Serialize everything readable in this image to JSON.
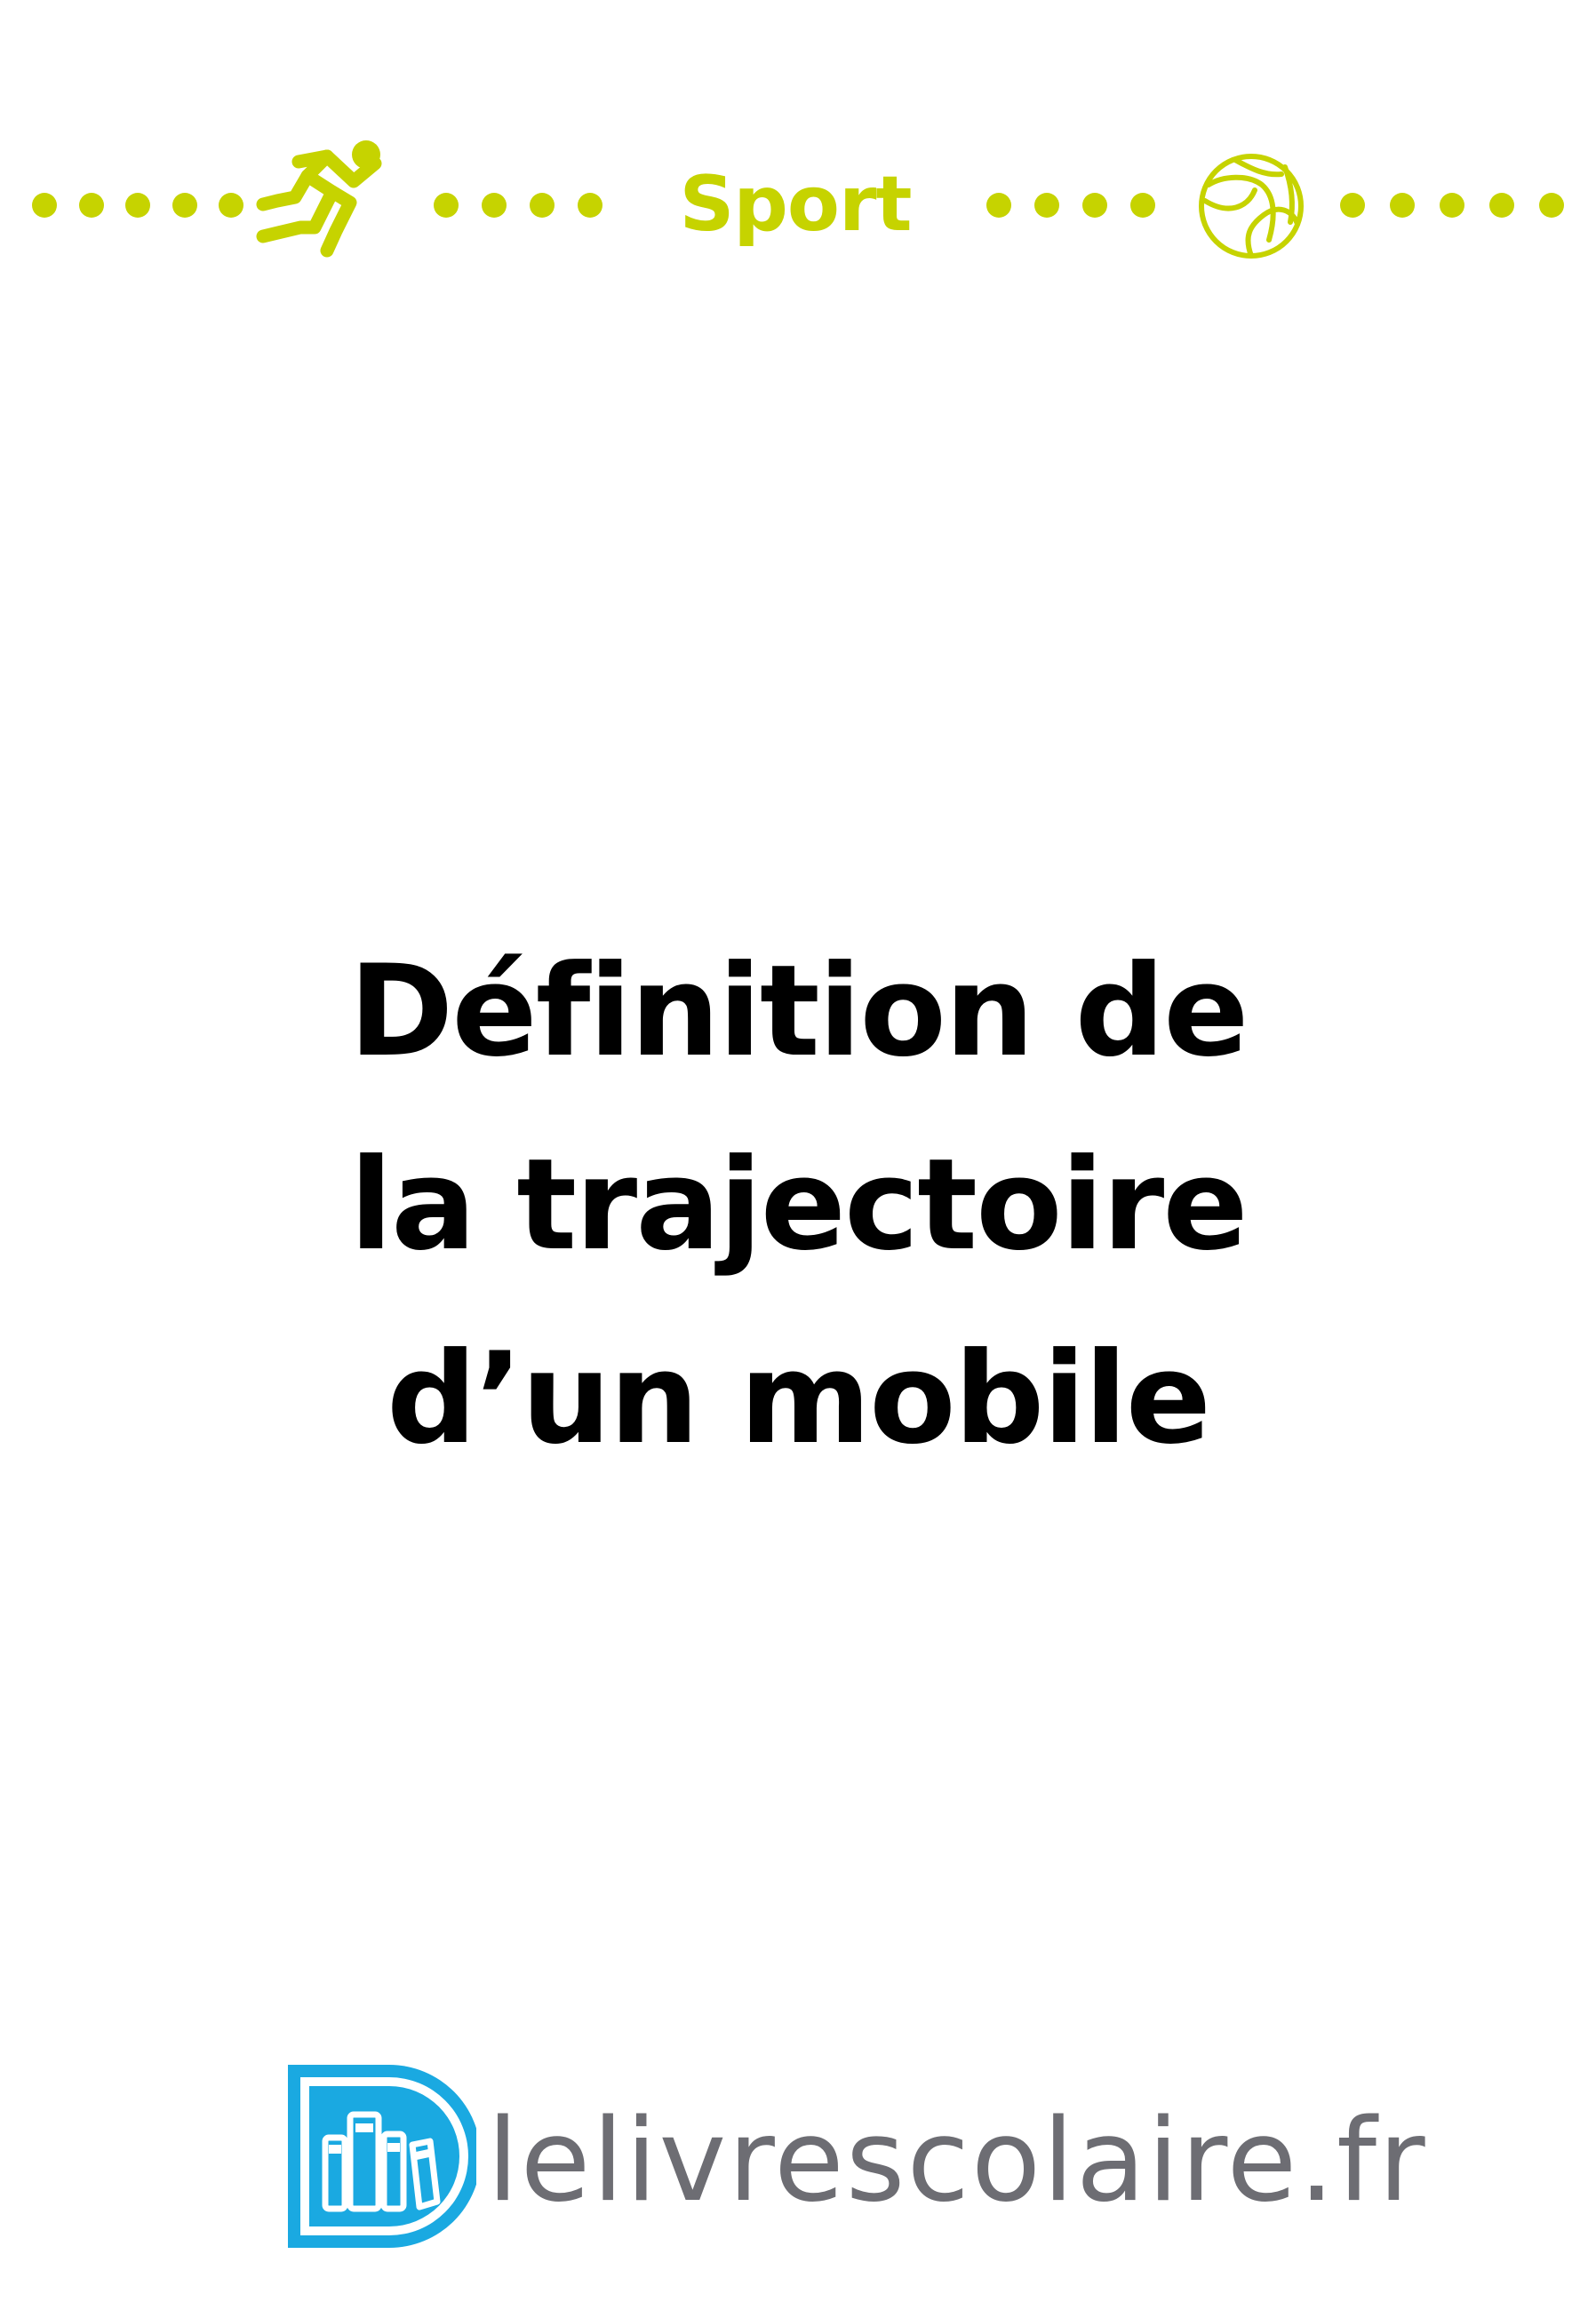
{
  "header": {
    "category": "Sport",
    "icons": {
      "left": "runner-icon",
      "right": "basketball-icon"
    },
    "accent_color": "#c6d300"
  },
  "title": {
    "lines": [
      "Définition de",
      "la trajectoire",
      "d’un mobile"
    ]
  },
  "footer": {
    "brand": "lelivrescolaire.fr",
    "logo_icon": "bookshelf-logo-icon",
    "logo_color": "#1aa9e1",
    "text_color": "#6d6d73"
  }
}
